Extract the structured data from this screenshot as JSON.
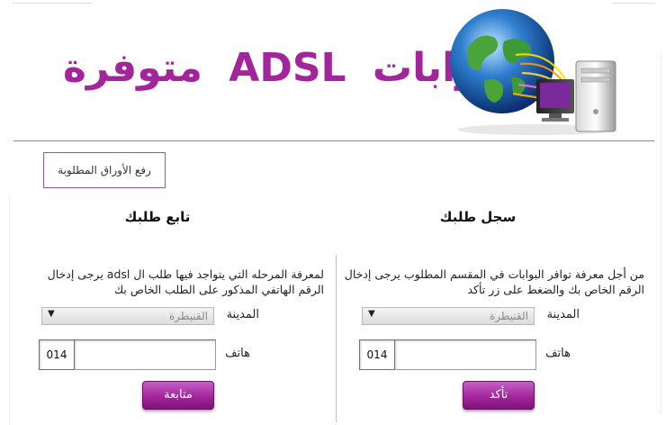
{
  "header": {
    "title_word_gateways": "بوابات",
    "title_word_adsl": "ADSL",
    "title_word_available": "متوفرة"
  },
  "upload_button_label": "رفع الأوراق المطلوبة",
  "register_panel": {
    "title": "سجل طلبك",
    "description": "من أجل معرفة توافر البوابات في المقسم المطلوب يرجى إدخال الرقم الخاص بك والضغط على زر تأكد",
    "city_label": "المدينة",
    "city_value": "القنيطرة",
    "phone_label": "هاتف",
    "phone_value": "",
    "phone_prefix": "014",
    "submit_label": "تأكد"
  },
  "follow_panel": {
    "title": "تابع طلبك",
    "description": "لمعرفة المرحله التي يتواجد فيها طلب ال adsl يرجى إدخال الرقم الهاتفي المذكور على الطلب الخاص بك",
    "city_label": "المدينة",
    "city_value": "القنيطرة",
    "phone_label": "هاتف",
    "phone_value": "",
    "phone_prefix": "014",
    "submit_label": "متابعة"
  },
  "colors": {
    "brand_purple": "#a3259c",
    "button_purple": "#a3259c"
  },
  "icons": {
    "logo": "globe-computer-network-logo",
    "select_arrow": "triangle-down-icon"
  }
}
